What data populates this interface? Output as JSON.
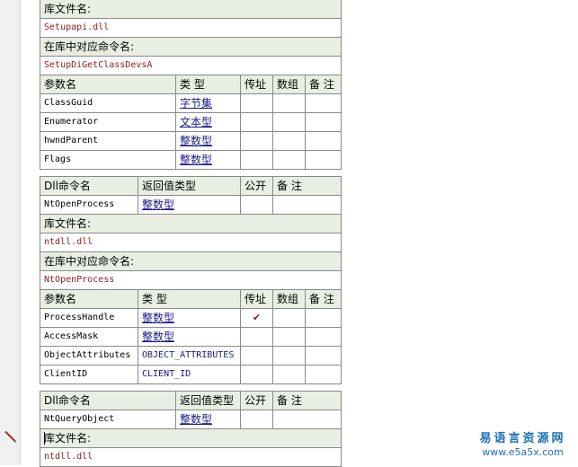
{
  "block1": {
    "lib_label": "库文件名:",
    "lib_value": "Setupapi.dll",
    "cmd_label": "在库中对应命令名:",
    "cmd_value": "SetupDiGetClassDevsA",
    "param_headers": [
      "参数名",
      "类 型",
      "传址",
      "数组",
      "备 注"
    ],
    "params": [
      {
        "name": "ClassGuid",
        "type": "字节集"
      },
      {
        "name": "Enumerator",
        "type": "文本型"
      },
      {
        "name": "hwndParent",
        "type": "整数型"
      },
      {
        "name": "Flags",
        "type": "整数型"
      }
    ]
  },
  "block2": {
    "headers": [
      "Dll命令名",
      "返回值类型",
      "公开",
      "备 注"
    ],
    "name": "NtOpenProcess",
    "return_type": "整数型",
    "lib_label": "库文件名:",
    "lib_value": "ntdll.dll",
    "cmd_label": "在库中对应命令名:",
    "cmd_value": "NtOpenProcess",
    "param_headers": [
      "参数名",
      "类 型",
      "传址",
      "数组",
      "备 注"
    ],
    "params": [
      {
        "name": "ProcessHandle",
        "type": "整数型",
        "byref": true
      },
      {
        "name": "AccessMask",
        "type": "整数型",
        "byref": false
      },
      {
        "name": "ObjectAttributes",
        "type": "OBJECT_ATTRIBUTES",
        "byref": false
      },
      {
        "name": "ClientID",
        "type": "CLIENT_ID",
        "byref": false
      }
    ],
    "check_mark": "✔"
  },
  "block3": {
    "headers": [
      "Dll命令名",
      "返回值类型",
      "公开",
      "备 注"
    ],
    "name": "NtQueryObject",
    "return_type": "整数型",
    "lib_label": "库文件名:",
    "lib_value": "ntdll.dll"
  },
  "watermark": {
    "line1": "易语言资源网",
    "line2": "www.e5a5x.com"
  },
  "colors": {
    "header_bg": "#e8efe2",
    "value_red": "#8b1a1a",
    "type_blue": "#1a1a8c",
    "grid": "#8a8a8a",
    "watermark": "#1a6fb8"
  },
  "icons": [
    "pencil-icon",
    "check-icon"
  ]
}
